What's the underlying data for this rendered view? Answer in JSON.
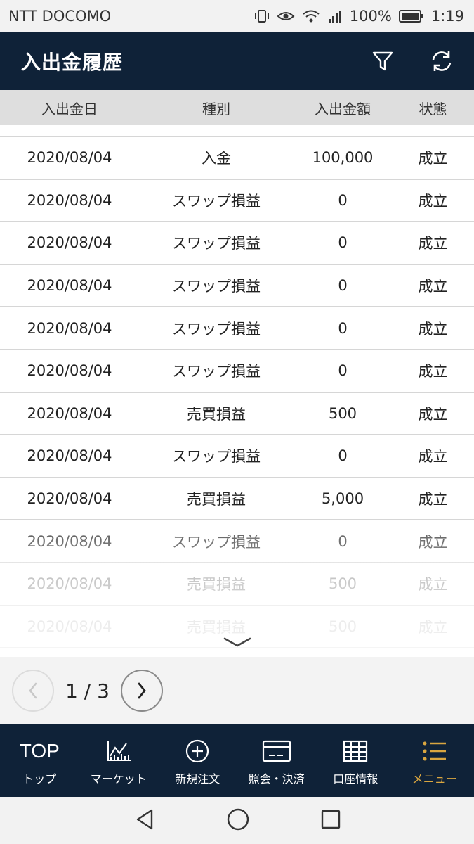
{
  "status_bar": {
    "carrier": "NTT DOCOMO",
    "battery_percent": "100%",
    "time": "1:19"
  },
  "header": {
    "title": "入出金履歴",
    "filter_icon": "filter-icon",
    "refresh_icon": "refresh-icon"
  },
  "columns": {
    "date": "入出金日",
    "type": "種別",
    "amount": "入出金額",
    "status": "状態"
  },
  "rows": [
    {
      "date": "2020/08/04",
      "type": "入金",
      "amount": "100,000",
      "status": "成立"
    },
    {
      "date": "2020/08/04",
      "type": "スワップ損益",
      "amount": "0",
      "status": "成立"
    },
    {
      "date": "2020/08/04",
      "type": "スワップ損益",
      "amount": "0",
      "status": "成立"
    },
    {
      "date": "2020/08/04",
      "type": "スワップ損益",
      "amount": "0",
      "status": "成立"
    },
    {
      "date": "2020/08/04",
      "type": "スワップ損益",
      "amount": "0",
      "status": "成立"
    },
    {
      "date": "2020/08/04",
      "type": "スワップ損益",
      "amount": "0",
      "status": "成立"
    },
    {
      "date": "2020/08/04",
      "type": "売買損益",
      "amount": "500",
      "status": "成立"
    },
    {
      "date": "2020/08/04",
      "type": "スワップ損益",
      "amount": "0",
      "status": "成立"
    },
    {
      "date": "2020/08/04",
      "type": "売買損益",
      "amount": "5,000",
      "status": "成立"
    },
    {
      "date": "2020/08/04",
      "type": "スワップ損益",
      "amount": "0",
      "status": "成立"
    },
    {
      "date": "2020/08/04",
      "type": "売買損益",
      "amount": "500",
      "status": "成立"
    },
    {
      "date": "2020/08/04",
      "type": "売買損益",
      "amount": "500",
      "status": "成立"
    }
  ],
  "pagination": {
    "text": "1 / 3"
  },
  "bottom_nav": {
    "items": [
      {
        "label": "トップ",
        "icon_text": "TOP"
      },
      {
        "label": "マーケット",
        "icon": "chart-icon"
      },
      {
        "label": "新規注文",
        "icon": "plus-circle-icon"
      },
      {
        "label": "照会・決済",
        "icon": "card-icon"
      },
      {
        "label": "口座情報",
        "icon": "grid-table-icon"
      },
      {
        "label": "メニュー",
        "icon": "menu-list-icon"
      }
    ],
    "active_color": "#d9a640"
  },
  "colors": {
    "header_bg": "#0f2238",
    "column_header_bg": "#dedede",
    "pager_bg": "#f3f3f3"
  }
}
